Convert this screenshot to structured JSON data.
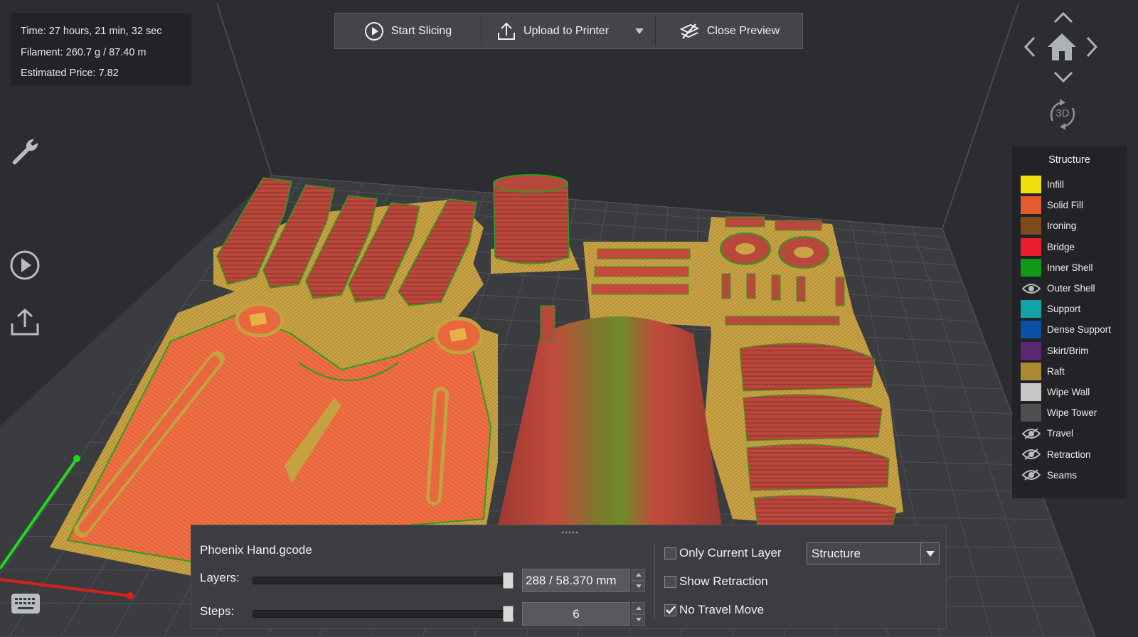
{
  "stats": {
    "time": "Time: 27 hours, 21 min, 32 sec",
    "filament": "Filament: 260.7 g / 87.40 m",
    "price": "Estimated Price: 7.82"
  },
  "toolbar": {
    "start_slicing": "Start Slicing",
    "upload": "Upload to Printer",
    "close_preview": "Close Preview"
  },
  "nav": {
    "view_3d": "3D"
  },
  "legend": {
    "title": "Structure",
    "items": [
      {
        "label": "Infill",
        "color": "#f2dd0f",
        "kind": "swatch"
      },
      {
        "label": "Solid Fill",
        "color": "#e55a2f",
        "kind": "swatch"
      },
      {
        "label": "Ironing",
        "color": "#7e4b1b",
        "kind": "swatch"
      },
      {
        "label": "Bridge",
        "color": "#ec1c2d",
        "kind": "swatch"
      },
      {
        "label": "Inner Shell",
        "color": "#0e9a18",
        "kind": "swatch"
      },
      {
        "label": "Outer Shell",
        "color": "",
        "kind": "eye-open"
      },
      {
        "label": "Support",
        "color": "#12a2a8",
        "kind": "swatch"
      },
      {
        "label": "Dense Support",
        "color": "#0c4fa4",
        "kind": "swatch"
      },
      {
        "label": "Skirt/Brim",
        "color": "#5c2773",
        "kind": "swatch"
      },
      {
        "label": "Raft",
        "color": "#a98a30",
        "kind": "swatch"
      },
      {
        "label": "Wipe Wall",
        "color": "#c7c7c7",
        "kind": "swatch"
      },
      {
        "label": "Wipe Tower",
        "color": "#4e4f51",
        "kind": "swatch"
      },
      {
        "label": "Travel",
        "color": "",
        "kind": "eye-closed"
      },
      {
        "label": "Retraction",
        "color": "",
        "kind": "eye-closed"
      },
      {
        "label": "Seams",
        "color": "",
        "kind": "eye-closed"
      }
    ]
  },
  "panel": {
    "filename": "Phoenix Hand.gcode",
    "layers_label": "Layers:",
    "layers_value": "288 / 58.370 mm",
    "layers_fraction": 1.0,
    "steps_label": "Steps:",
    "steps_value": "6",
    "steps_fraction": 1.0,
    "only_current_layer": "Only Current Layer",
    "only_current_layer_checked": false,
    "show_retraction": "Show Retraction",
    "show_retraction_checked": false,
    "no_travel_move": "No Travel Move",
    "no_travel_move_checked": true,
    "view_mode": "Structure"
  }
}
